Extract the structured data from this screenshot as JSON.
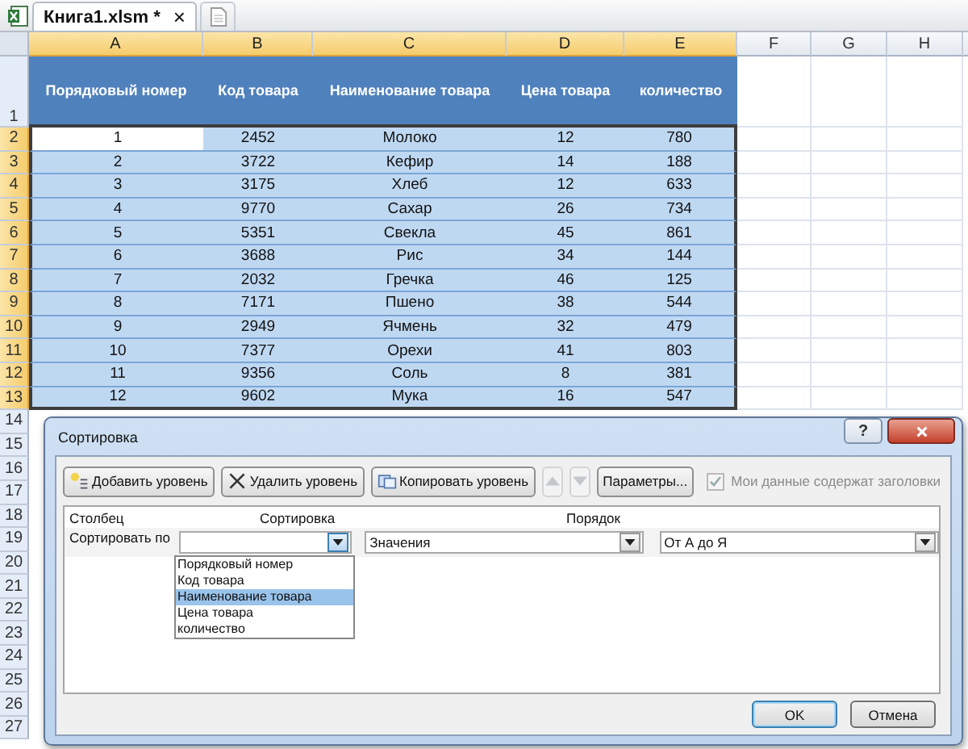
{
  "tabs": [
    {
      "label": "Книга1.xlsm *",
      "close": "×",
      "selected": true
    }
  ],
  "sheet": {
    "columns": [
      {
        "label": "A",
        "selected": true
      },
      {
        "label": "B",
        "selected": true
      },
      {
        "label": "C",
        "selected": true
      },
      {
        "label": "D",
        "selected": true
      },
      {
        "label": "E",
        "selected": true
      },
      {
        "label": "F",
        "selected": false
      },
      {
        "label": "G",
        "selected": false
      },
      {
        "label": "H",
        "selected": false
      }
    ],
    "header_row": {
      "label": "1",
      "selected": false,
      "cells": [
        "Порядковый номер",
        "Код товара",
        "Наименование товара",
        "Цена товара",
        "количество"
      ]
    },
    "rows": [
      {
        "label": "2",
        "selected": true,
        "cells": [
          {
            "text": "1",
            "active": true
          },
          {
            "text": "2452",
            "active": false
          },
          {
            "text": "Молоко",
            "active": false
          },
          {
            "text": "12",
            "active": false
          },
          {
            "text": "780",
            "active": false
          }
        ]
      },
      {
        "label": "3",
        "selected": true,
        "cells": [
          {
            "text": "2",
            "active": false
          },
          {
            "text": "3722",
            "active": false
          },
          {
            "text": "Кефир",
            "active": false
          },
          {
            "text": "14",
            "active": false
          },
          {
            "text": "188",
            "active": false
          }
        ]
      },
      {
        "label": "4",
        "selected": true,
        "cells": [
          {
            "text": "3",
            "active": false
          },
          {
            "text": "3175",
            "active": false
          },
          {
            "text": "Хлеб",
            "active": false
          },
          {
            "text": "12",
            "active": false
          },
          {
            "text": "633",
            "active": false
          }
        ]
      },
      {
        "label": "5",
        "selected": true,
        "cells": [
          {
            "text": "4",
            "active": false
          },
          {
            "text": "9770",
            "active": false
          },
          {
            "text": "Сахар",
            "active": false
          },
          {
            "text": "26",
            "active": false
          },
          {
            "text": "734",
            "active": false
          }
        ]
      },
      {
        "label": "6",
        "selected": true,
        "cells": [
          {
            "text": "5",
            "active": false
          },
          {
            "text": "5351",
            "active": false
          },
          {
            "text": "Свекла",
            "active": false
          },
          {
            "text": "45",
            "active": false
          },
          {
            "text": "861",
            "active": false
          }
        ]
      },
      {
        "label": "7",
        "selected": true,
        "cells": [
          {
            "text": "6",
            "active": false
          },
          {
            "text": "3688",
            "active": false
          },
          {
            "text": "Рис",
            "active": false
          },
          {
            "text": "34",
            "active": false
          },
          {
            "text": "144",
            "active": false
          }
        ]
      },
      {
        "label": "8",
        "selected": true,
        "cells": [
          {
            "text": "7",
            "active": false
          },
          {
            "text": "2032",
            "active": false
          },
          {
            "text": "Гречка",
            "active": false
          },
          {
            "text": "46",
            "active": false
          },
          {
            "text": "125",
            "active": false
          }
        ]
      },
      {
        "label": "9",
        "selected": true,
        "cells": [
          {
            "text": "8",
            "active": false
          },
          {
            "text": "7171",
            "active": false
          },
          {
            "text": "Пшено",
            "active": false
          },
          {
            "text": "38",
            "active": false
          },
          {
            "text": "544",
            "active": false
          }
        ]
      },
      {
        "label": "10",
        "selected": true,
        "cells": [
          {
            "text": "9",
            "active": false
          },
          {
            "text": "2949",
            "active": false
          },
          {
            "text": "Ячмень",
            "active": false
          },
          {
            "text": "32",
            "active": false
          },
          {
            "text": "479",
            "active": false
          }
        ]
      },
      {
        "label": "11",
        "selected": true,
        "cells": [
          {
            "text": "10",
            "active": false
          },
          {
            "text": "7377",
            "active": false
          },
          {
            "text": "Орехи",
            "active": false
          },
          {
            "text": "41",
            "active": false
          },
          {
            "text": "803",
            "active": false
          }
        ]
      },
      {
        "label": "12",
        "selected": true,
        "cells": [
          {
            "text": "11",
            "active": false
          },
          {
            "text": "9356",
            "active": false
          },
          {
            "text": "Соль",
            "active": false
          },
          {
            "text": "8",
            "active": false
          },
          {
            "text": "381",
            "active": false
          }
        ]
      },
      {
        "label": "13",
        "selected": true,
        "cells": [
          {
            "text": "12",
            "active": false
          },
          {
            "text": "9602",
            "active": false
          },
          {
            "text": "Мука",
            "active": false
          },
          {
            "text": "16",
            "active": false
          },
          {
            "text": "547",
            "active": false
          }
        ]
      }
    ],
    "empty_rows": [
      "14",
      "15",
      "16",
      "17",
      "18",
      "19",
      "20",
      "21",
      "22",
      "23",
      "24",
      "25",
      "26",
      "27"
    ]
  },
  "dialog": {
    "title": "Сортировка",
    "help": "?",
    "toolbar": [
      {
        "kind": "add",
        "label": "Добавить уровень",
        "disabled": false
      },
      {
        "kind": "delete",
        "label": "Удалить уровень",
        "disabled": false
      },
      {
        "kind": "copy",
        "label": "Копировать уровень",
        "disabled": false
      },
      {
        "kind": "up",
        "disabled": true
      },
      {
        "kind": "down",
        "disabled": true
      },
      {
        "kind": "plain",
        "label": "Параметры...",
        "disabled": false
      }
    ],
    "headers_checkbox": {
      "label": "Мои данные содержат заголовки",
      "checked": true,
      "disabled": true
    },
    "columns": [
      "Столбец",
      "Сортировка",
      "Порядок"
    ],
    "level": {
      "label": "Сортировать по",
      "column": {
        "expanded": true,
        "options": [
          {
            "label": "Порядковый номер",
            "selected": false
          },
          {
            "label": "Код товара",
            "selected": false
          },
          {
            "label": "Наименование товара",
            "selected": true
          },
          {
            "label": "Цена товара",
            "selected": false
          },
          {
            "label": "количество",
            "selected": false
          }
        ]
      },
      "sort_on": "Значения",
      "order": "От А до Я"
    },
    "buttons": [
      {
        "label": "OK",
        "default": true
      },
      {
        "label": "Отмена",
        "default": false
      }
    ]
  }
}
